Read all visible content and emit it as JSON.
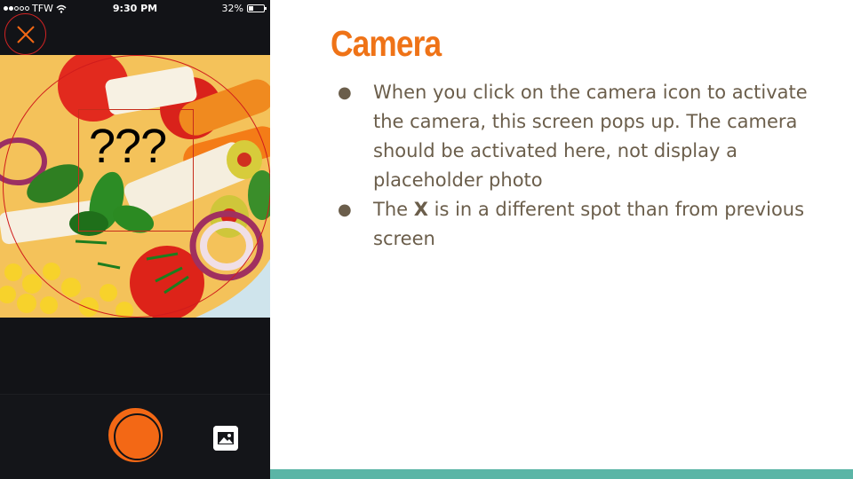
{
  "status_bar": {
    "carrier": "TFW",
    "time": "9:30 PM",
    "battery": "32%"
  },
  "camera_screen": {
    "overlay_text": "???",
    "icons": {
      "close": "close-icon",
      "shutter": "shutter-button",
      "gallery": "image-gallery-icon",
      "wifi": "wifi-icon",
      "battery": "battery-icon"
    },
    "colors": {
      "accent": "#f36815",
      "focus_ring": "#d01c1c",
      "background": "#121317"
    }
  },
  "slide": {
    "title": "Camera",
    "bullets": [
      {
        "text": "When you click on the camera icon to activate the camera, this screen pops up. The camera should be activated here, not display a placeholder photo"
      },
      {
        "prefix": "The ",
        "bold": "X",
        "suffix": " is in a different spot than from previous screen"
      }
    ],
    "colors": {
      "title": "#ef7317",
      "body_text": "#6b5e4b",
      "accent_bar": "#5bb5a6"
    }
  }
}
